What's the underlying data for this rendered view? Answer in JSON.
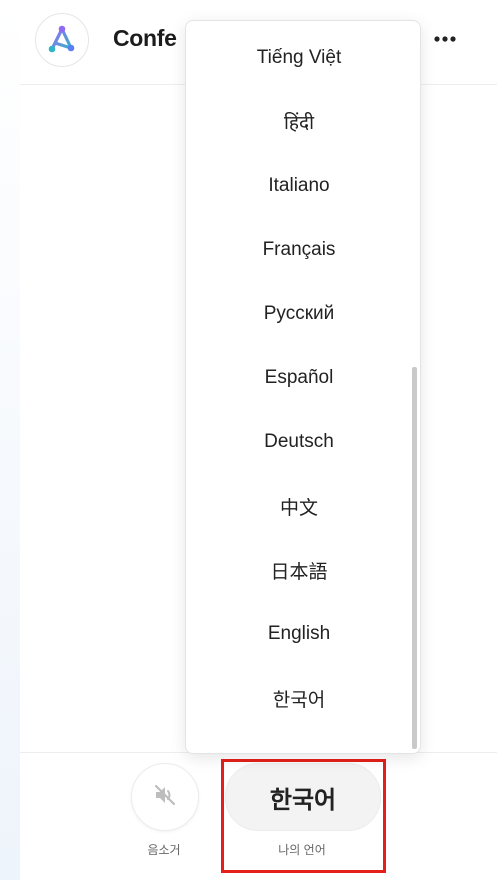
{
  "app": {
    "title": "Confe"
  },
  "language_menu": {
    "options": [
      "Tiếng Việt",
      "हिंदी",
      "Italiano",
      "Français",
      "Русский",
      "Español",
      "Deutsch",
      "中文",
      "日本語",
      "English",
      "한국어"
    ]
  },
  "controls": {
    "mute_label": "음소거",
    "language_button": "한국어",
    "language_label": "나의 언어"
  },
  "colors": {
    "highlight": "#e3201b",
    "logo_gradient": [
      "#7b5cf0",
      "#2bb6c9"
    ]
  },
  "icons": {
    "logo": "triangle-network-logo",
    "more": "more-horizontal-icon",
    "mute": "speaker-muted-icon"
  }
}
